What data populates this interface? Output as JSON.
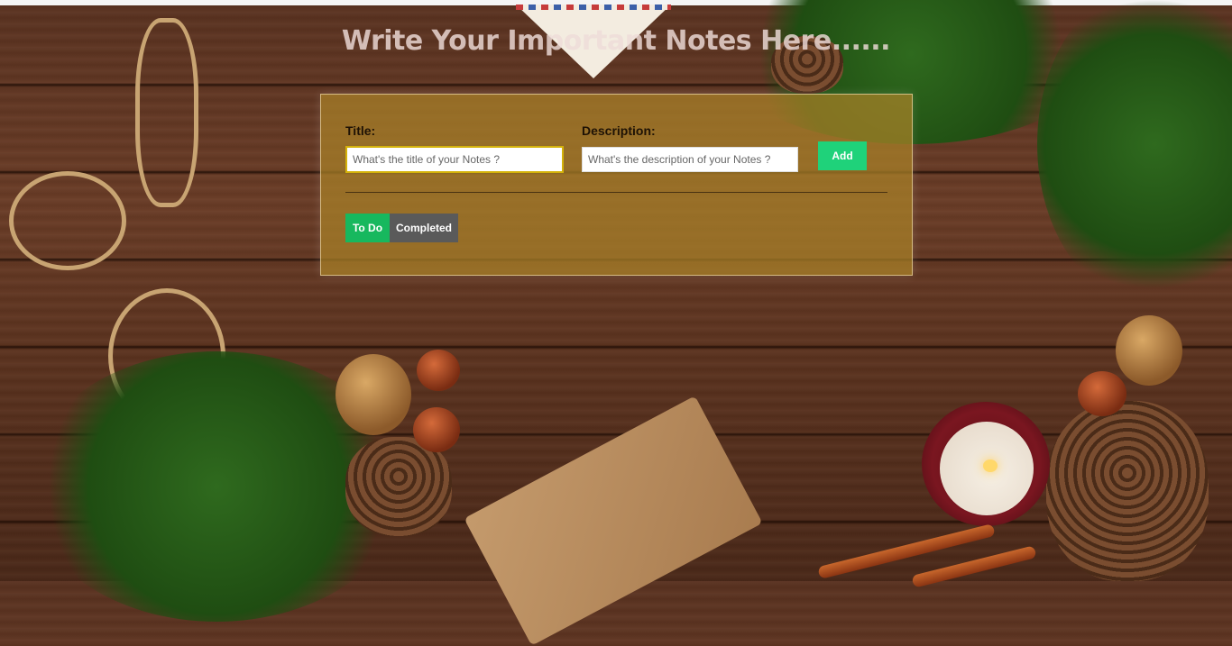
{
  "page": {
    "title": "Write Your Important Notes Here......"
  },
  "form": {
    "title_label": "Title:",
    "title_placeholder": "What's the title of your Notes ?",
    "title_value": "",
    "description_label": "Description:",
    "description_placeholder": "What's the description of your Notes ?",
    "description_value": "",
    "add_label": "Add"
  },
  "tabs": [
    {
      "label": "To Do",
      "active": true
    },
    {
      "label": "Completed",
      "active": false
    }
  ],
  "colors": {
    "add_button": "#1fd27a",
    "active_tab": "#17b85e",
    "inactive_tab": "#5a5a5a",
    "panel": "#aa8228",
    "title_input_border": "#d4b20a"
  }
}
